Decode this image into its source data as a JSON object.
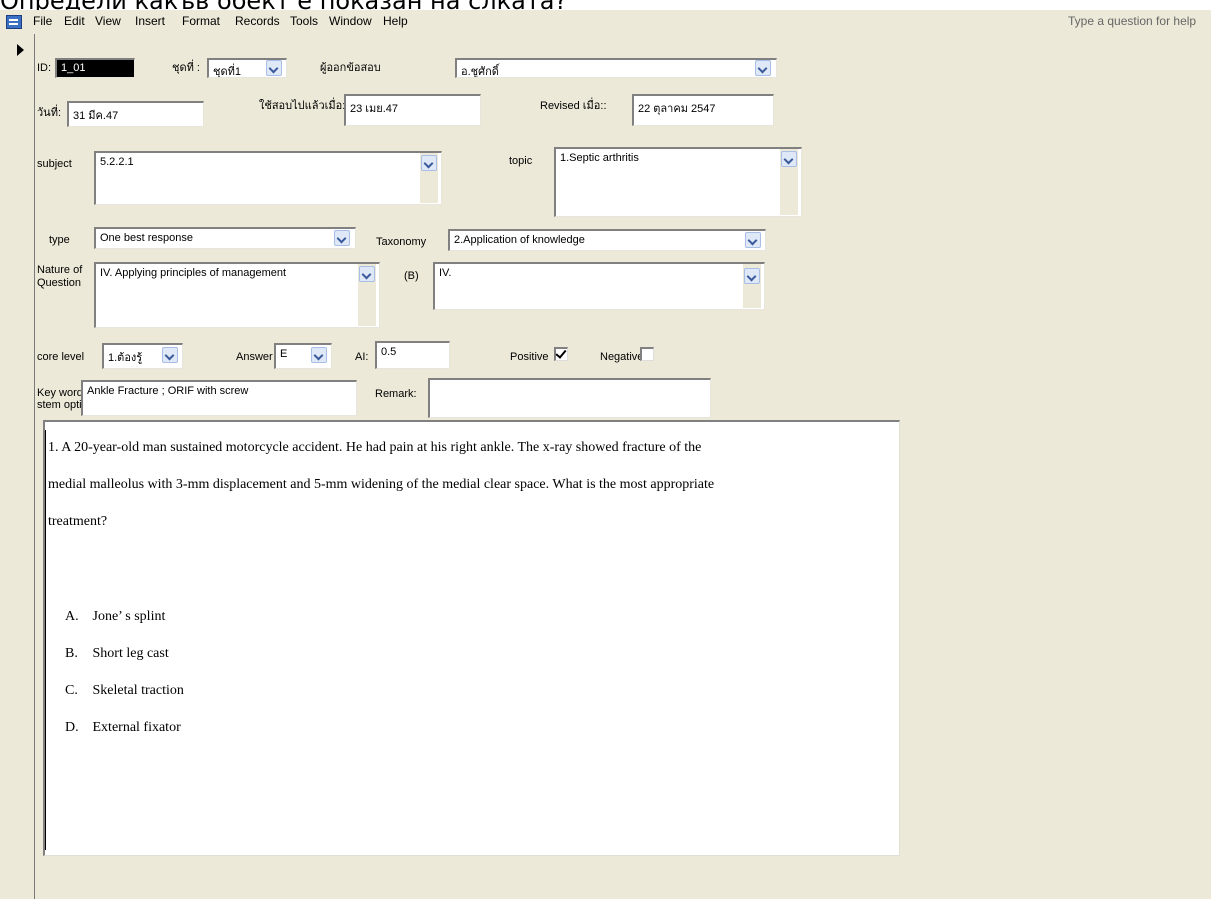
{
  "caption": "Определи какъв обект е показан на слката?",
  "menu": {
    "items": [
      "File",
      "Edit",
      "View",
      "Insert",
      "Format",
      "Records",
      "Tools",
      "Window",
      "Help"
    ],
    "help_placeholder": "Type a question for help"
  },
  "form": {
    "id_label": "ID:",
    "id_value": "1_01",
    "set_label": "ชุดที่ :",
    "set_value": "ชุดที่1",
    "author_label": "ผู้ออกข้อสอบ",
    "author_value": "อ.ชูศักดิ์",
    "date_label": "วันที่:",
    "date_value": "31 มีค.47",
    "used_label": "ใช้สอบไปแล้วเมื่อ::",
    "used_value": "23 เมย.47",
    "revised_label": "Revised เมื่อ::",
    "revised_value": "22 ตุลาคม 2547",
    "subject_label": "subject",
    "subject_value": "5.2.2.1",
    "topic_label": "topic",
    "topic_value": "1.Septic arthritis",
    "type_label": "type",
    "type_value": "One best response",
    "taxonomy_label": "Taxonomy",
    "taxonomy_value": "2.Application of knowledge",
    "nature_label": "Nature of Question",
    "nature_value": "IV. Applying principles of management",
    "b_label": "(B)",
    "b_value": "IV.",
    "core_label": "core level",
    "core_value": "1.ต้องรู้",
    "answer_label": "Answer",
    "answer_value": "E",
    "ai_label": "AI:",
    "ai_value": "0.5",
    "positive_label": "Positive",
    "positive_checked": true,
    "negative_label": "Negative",
    "negative_checked": false,
    "keyword_label": "Key word:",
    "keyword_value": "Ankle Fracture ; ORIF with screw",
    "stem_label": "stem option:",
    "remark_label": "Remark:",
    "remark_value": ""
  },
  "question": {
    "line1": "1.   A 20-year-old man sustained motorcycle accident. He had pain at his right ankle. The x-ray showed fracture of the",
    "line2": "medial malleolus with 3-mm displacement and 5-mm widening of the medial clear space.  What is the most appropriate",
    "line3": "treatment?",
    "choices": [
      {
        "letter": "A.",
        "text": "Jone’ s  splint"
      },
      {
        "letter": "B.",
        "text": "Short leg cast"
      },
      {
        "letter": "C.",
        "text": "Skeletal  traction"
      },
      {
        "letter": "D.",
        "text": "External fixator"
      }
    ]
  }
}
